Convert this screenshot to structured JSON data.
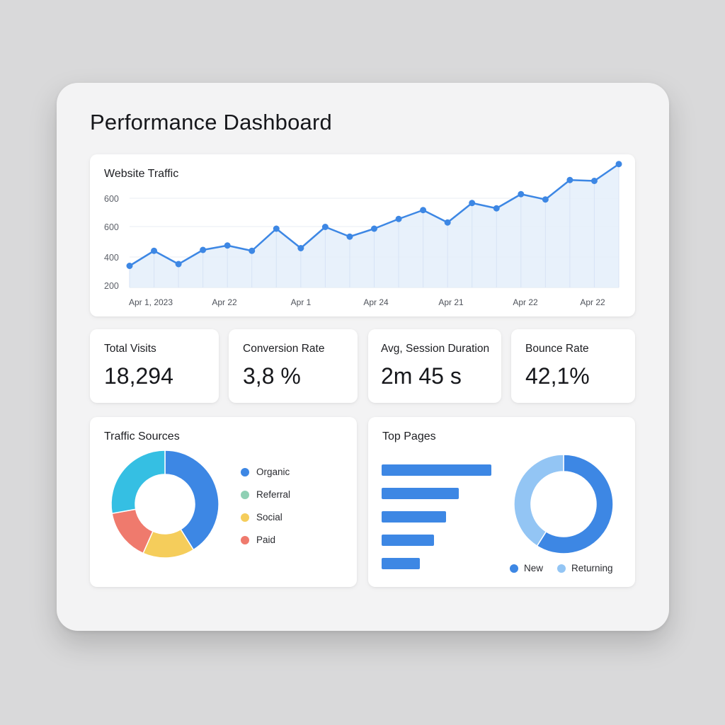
{
  "dashboard": {
    "title": "Performance Dashboard"
  },
  "colors": {
    "accent": "#3d87e4",
    "area_fill": "#e6effb",
    "organic": "#3d87e4",
    "referral": "#8fd0b4",
    "social": "#f5cd5b",
    "paid": "#ef7a6d",
    "returning": "#93c5f4",
    "teal_segment": "#35bfe3"
  },
  "traffic": {
    "title": "Website Traffic"
  },
  "chart_data": [
    {
      "type": "line",
      "title": "Website Traffic",
      "yticks": [
        "200",
        "400",
        "600",
        "600"
      ],
      "xticks": [
        "Apr 1, 2023",
        "Apr 22",
        "Apr 1",
        "Apr 24",
        "Apr 21",
        "Apr 22",
        "Apr 22"
      ],
      "ylim": [
        200,
        800
      ],
      "grid": true,
      "area_fill": true,
      "series": [
        {
          "values": [
            330,
            415,
            340,
            420,
            445,
            415,
            540,
            430,
            550,
            495,
            540,
            595,
            645,
            575,
            685,
            655,
            735,
            705,
            815,
            810,
            905
          ]
        }
      ]
    },
    {
      "type": "pie",
      "title": "Traffic Sources",
      "donut": true,
      "categories": [
        "Organic",
        "Referral",
        "Social",
        "Paid",
        ""
      ],
      "values": [
        37,
        0,
        14,
        14,
        25
      ],
      "colors": [
        "#3d87e4",
        "#8fd0b4",
        "#f5cd5b",
        "#ef7a6d",
        "#35bfe3"
      ],
      "legend": "right"
    },
    {
      "type": "bar",
      "title": "Top Pages",
      "orientation": "horizontal",
      "values": [
        100,
        70,
        59,
        48,
        35
      ]
    },
    {
      "type": "pie",
      "donut": true,
      "categories": [
        "New",
        "Returning"
      ],
      "values": [
        59,
        41
      ],
      "colors": [
        "#3d87e4",
        "#93c5f4"
      ],
      "legend": "bottom"
    }
  ],
  "stats": [
    {
      "label": "Total Visits",
      "value": "18,294"
    },
    {
      "label": "Conversion Rate",
      "value": "3,8 %"
    },
    {
      "label": "Avg, Session Duration",
      "value": "2m 45 s"
    },
    {
      "label": "Bounce Rate",
      "value": "42,1%"
    }
  ],
  "sources": {
    "title": "Traffic Sources",
    "legend": [
      "Organic",
      "Referral",
      "Social",
      "Paid"
    ]
  },
  "pages": {
    "title": "Top Pages",
    "legend": [
      "New",
      "Returning"
    ]
  }
}
